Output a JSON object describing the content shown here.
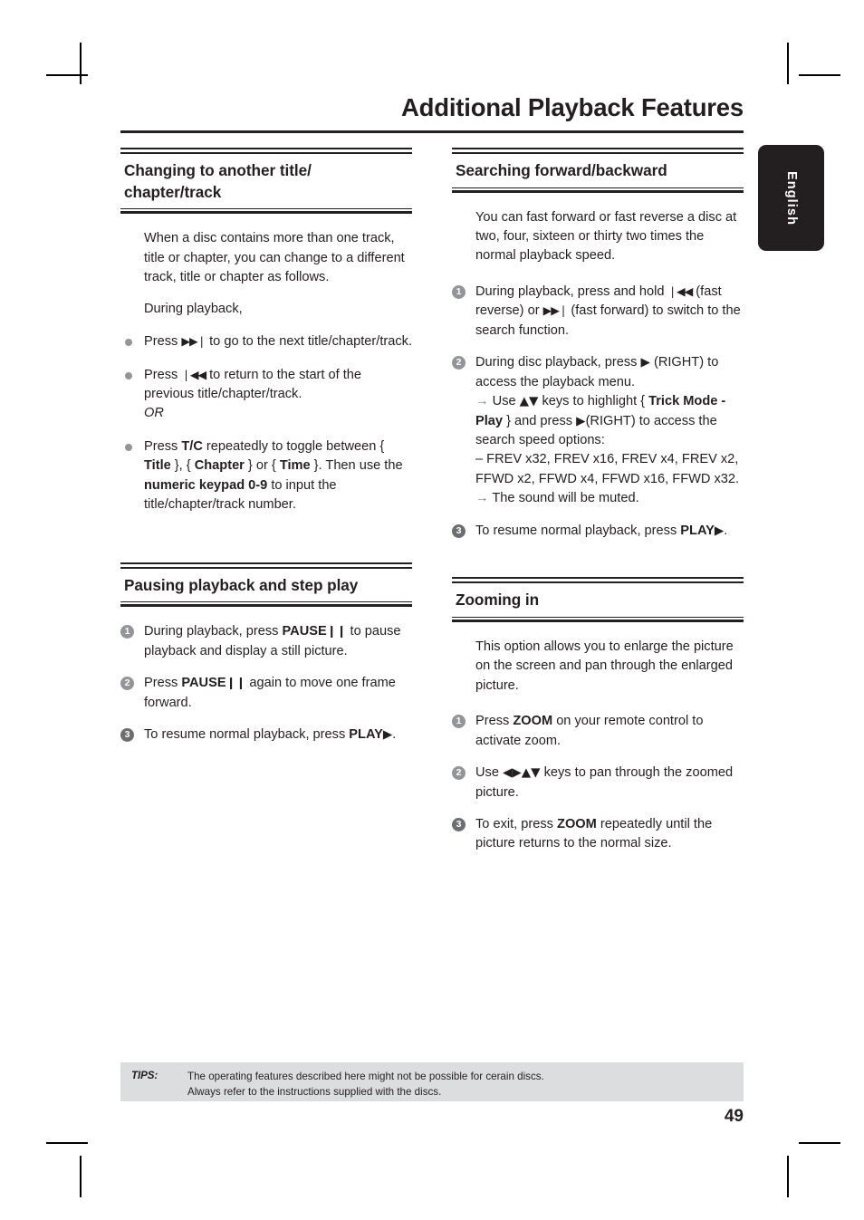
{
  "page": {
    "title": "Additional Playback Features",
    "number": "49",
    "language_tab": "English"
  },
  "tips": {
    "label": "TIPS:",
    "lines": [
      "The operating features described here might not be possible for cerain discs.",
      "Always refer to the instructions supplied with the discs."
    ]
  },
  "left_column": {
    "section1": {
      "heading": "Changing to another title/ chapter/track",
      "intro": "When a disc contains more than one track, title or chapter, you can change to a different track, title or chapter as follows.",
      "lead": "During playback,",
      "bullets": [
        {
          "pre": "Press ",
          "glyph": "▶▶❘",
          "post": " to go to the next title/chapter/track.",
          "glyph_name": "next-track-icon"
        },
        {
          "pre": "Press ",
          "glyph": "❘◀◀",
          "post": " to return to the start of the previous title/chapter/track.",
          "or": "OR",
          "glyph_name": "previous-track-icon"
        },
        {
          "pre": "Press ",
          "bold1": "T/C",
          "mid1": " repeatedly to toggle between { ",
          "bold2": "Title",
          "mid2": " }, { ",
          "bold3": "Chapter",
          "mid3": " } or { ",
          "bold4": "Time",
          "mid4": " }. Then use the ",
          "bold5": "numeric keypad 0-9",
          "post": " to input the title/chapter/track number.",
          "glyph_name": "tc-button-label"
        }
      ]
    },
    "section2": {
      "heading": "Pausing playback and step play",
      "steps": [
        {
          "n": "1",
          "pre": "During playback, press ",
          "bold": "PAUSE",
          "glyph": "❙❙",
          "post": " to pause playback and display a still picture.",
          "glyph_name": "pause-icon"
        },
        {
          "n": "2",
          "pre": "Press ",
          "bold": "PAUSE",
          "glyph": "❙❙",
          "post": " again to move one frame forward.",
          "glyph_name": "pause-icon"
        },
        {
          "n": "3",
          "pre": "To resume normal playback, press ",
          "bold": "PLAY",
          "glyph": "▶",
          "post": ".",
          "glyph_name": "play-icon"
        }
      ]
    }
  },
  "right_column": {
    "section1": {
      "heading": "Searching forward/backward",
      "intro": "You can fast forward or fast reverse a disc at two, four, sixteen or thirty two times the normal playback speed.",
      "steps": [
        {
          "n": "1",
          "pre": "During playback, press and hold ",
          "glyph1": "❘◀◀",
          "mid": " (fast reverse) or ",
          "glyph2": "▶▶❘",
          "post": " (fast forward) to switch to the search function."
        },
        {
          "n": "2",
          "pre": "During disc playback, press ",
          "glyph1": "▶",
          "post": " (RIGHT) to access the playback menu.",
          "sub1": {
            "arrow": "→",
            "pre": " Use ",
            "glyph": "▲▼",
            "mid1": " keys to highlight { ",
            "bold1": "Trick Mode - Play",
            "mid2": " } and press ",
            "glyph2": "▶",
            "post": "(RIGHT) to access the search speed options:"
          },
          "dash_item": "–   FREV x32, FREV x16, FREV x4, FREV x2, FFWD x2, FFWD x4, FFWD x16, FFWD x32.",
          "sub2": {
            "arrow": "→",
            "text": " The sound will be muted."
          }
        },
        {
          "n": "3",
          "pre": "To resume normal playback, press ",
          "bold": "PLAY",
          "glyph1": "▶",
          "post": "."
        }
      ]
    },
    "section2": {
      "heading": "Zooming in",
      "intro": "This option allows you to enlarge the picture on the screen and pan through the enlarged picture.",
      "steps": [
        {
          "n": "1",
          "pre": "Press ",
          "bold": "ZOOM",
          "post": " on your remote control to activate zoom."
        },
        {
          "n": "2",
          "pre": "Use ",
          "glyph": "◀▶▲▼",
          "post": " keys to pan through the zoomed picture."
        },
        {
          "n": "3",
          "pre": "To exit, press ",
          "bold": "ZOOM",
          "post": " repeatedly until the picture returns to the normal size."
        }
      ]
    }
  }
}
